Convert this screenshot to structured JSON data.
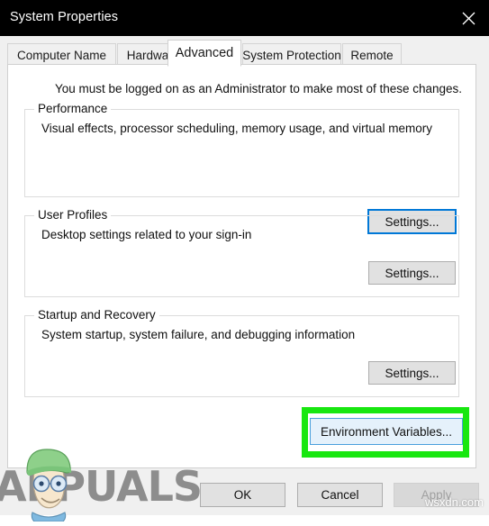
{
  "window": {
    "title": "System Properties",
    "close_icon": "close-icon",
    "titlebar_bg": "#000000",
    "titlebar_fg": "#ffffff"
  },
  "tabs": [
    {
      "label": "Computer Name",
      "selected": false
    },
    {
      "label": "Hardware",
      "selected": false
    },
    {
      "label": "Advanced",
      "selected": true
    },
    {
      "label": "System Protection",
      "selected": false
    },
    {
      "label": "Remote",
      "selected": false
    }
  ],
  "page": {
    "intro": "You must be logged on as an Administrator to make most of these changes.",
    "groups": [
      {
        "title": "Performance",
        "description": "Visual effects, processor scheduling, memory usage, and virtual memory",
        "button": "Settings..."
      },
      {
        "title": "User Profiles",
        "description": "Desktop settings related to your sign-in",
        "button": "Settings..."
      },
      {
        "title": "Startup and Recovery",
        "description": "System startup, system failure, and debugging information",
        "button": "Settings..."
      }
    ],
    "environment_variables_button": "Environment Variables...",
    "highlight_color": "#18e710"
  },
  "footer": {
    "ok": "OK",
    "cancel": "Cancel",
    "apply": "Apply",
    "apply_disabled": true
  },
  "watermarks": {
    "brand": "APPUALS",
    "site": "wsxdn.com"
  },
  "colors": {
    "accent_focus": "#0078d7",
    "hover_fill": "#e5f1fb",
    "button_face": "#e1e1e1",
    "dialog_face": "#f0f0f0",
    "panel": "#ffffff"
  }
}
